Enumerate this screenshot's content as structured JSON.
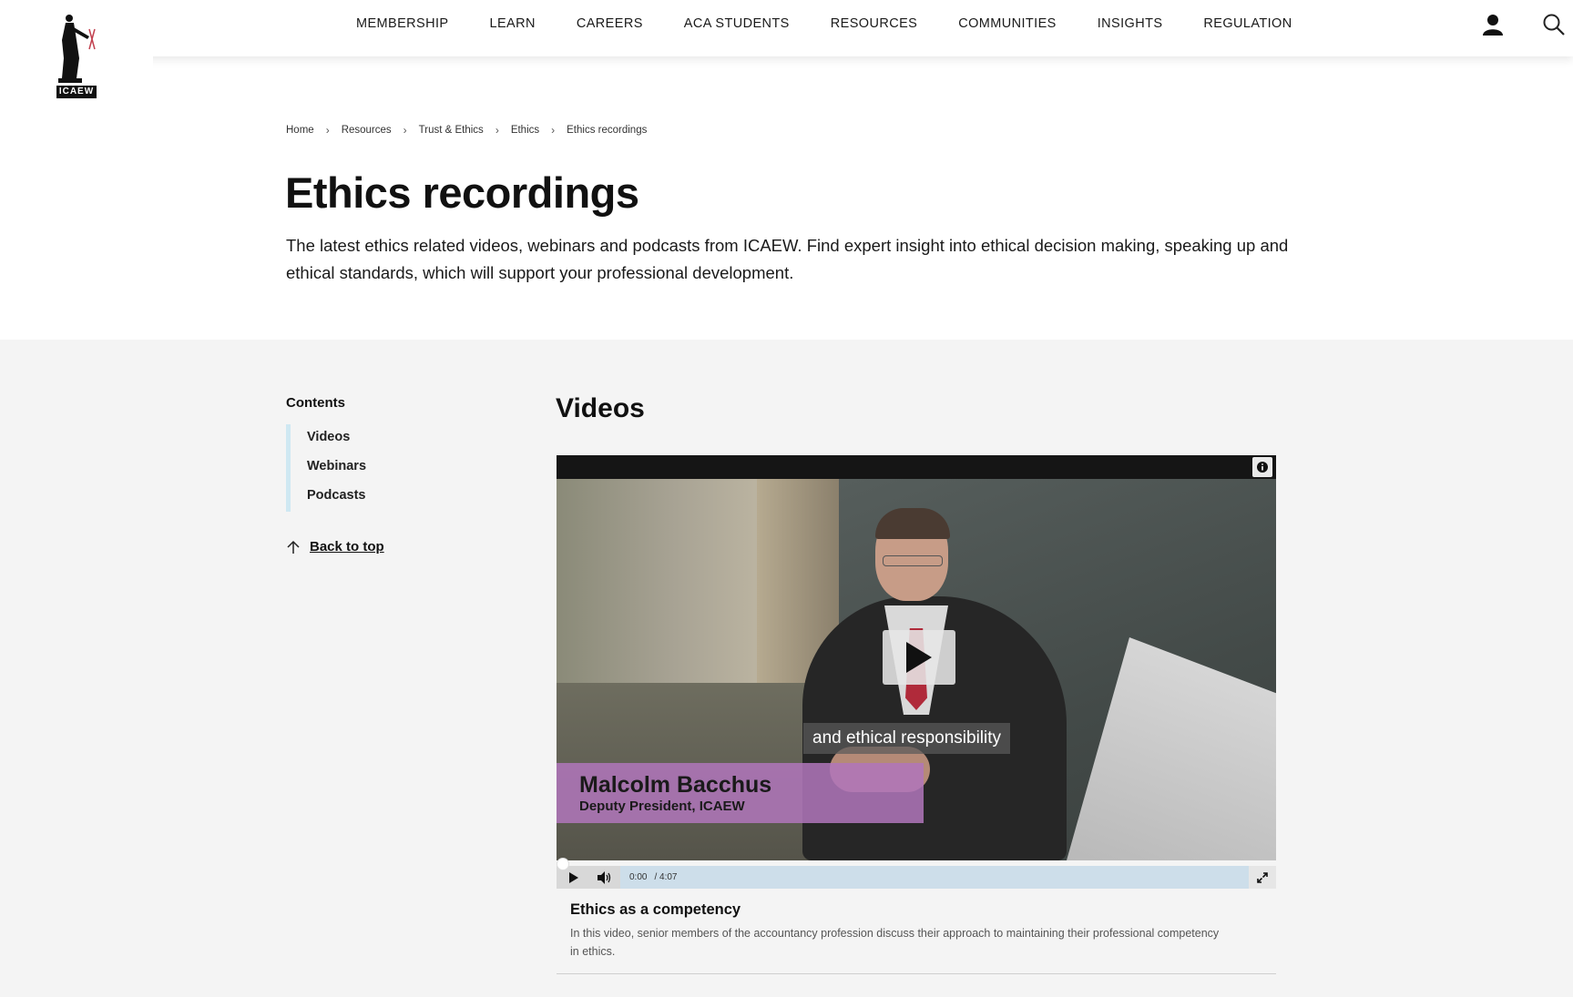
{
  "header": {
    "logo_text": "ICAEW",
    "nav": [
      "MEMBERSHIP",
      "LEARN",
      "CAREERS",
      "ACA STUDENTS",
      "RESOURCES",
      "COMMUNITIES",
      "INSIGHTS",
      "REGULATION"
    ],
    "icons": [
      "user-icon",
      "search-icon"
    ]
  },
  "breadcrumb": [
    "Home",
    "Resources",
    "Trust & Ethics",
    "Ethics",
    "Ethics recordings"
  ],
  "page": {
    "title": "Ethics recordings",
    "intro": "The latest ethics related videos, webinars and podcasts from ICAEW. Find expert insight into ethical decision making, speaking up and ethical standards, which will support your professional development."
  },
  "contents": {
    "title": "Contents",
    "items": [
      "Videos",
      "Webinars",
      "Podcasts"
    ],
    "back_to_top": "Back to top"
  },
  "videos": {
    "section_title": "Videos",
    "player": {
      "caption": "and ethical responsibility",
      "name": "Malcolm Bacchus",
      "role": "Deputy President, ICAEW",
      "time_current": "0:00",
      "time_total": "/ 4:07"
    },
    "item": {
      "title": "Ethics as a competency",
      "description": "In this video, senior members of the accountancy profession discuss their approach to maintaining their professional competency in ethics."
    }
  }
}
